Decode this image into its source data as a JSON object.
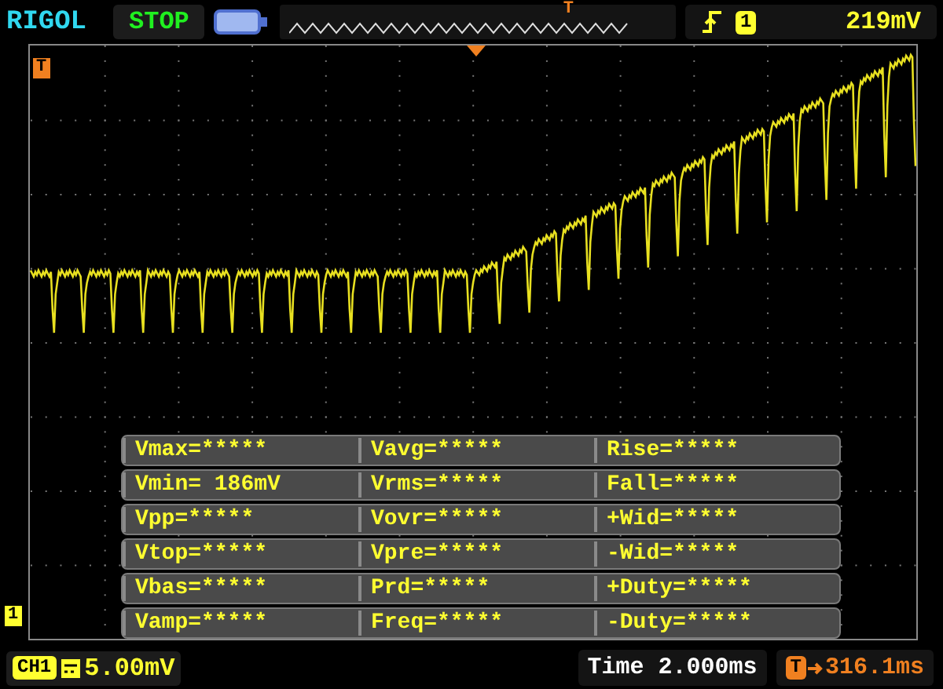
{
  "brand": "RIGOL",
  "run_state": "STOP",
  "memory_marker": "T",
  "trigger": {
    "channel": "1",
    "level": "219mV"
  },
  "trigger_level_marker": "T",
  "channel_marker": "1",
  "measurements": [
    [
      "Vmax=*****",
      "Vavg=*****",
      "Rise=*****"
    ],
    [
      "Vmin= 186mV",
      "Vrms=*****",
      "Fall=*****"
    ],
    [
      "Vpp=*****",
      "Vovr=*****",
      "+Wid=*****"
    ],
    [
      "Vtop=*****",
      "Vpre=*****",
      "-Wid=*****"
    ],
    [
      "Vbas=*****",
      "Prd=*****",
      "+Duty=*****"
    ],
    [
      "Vamp=*****",
      "Freq=*****",
      "-Duty=*****"
    ]
  ],
  "channel": {
    "name": "CH1",
    "scale": "5.00mV"
  },
  "timebase": "Time 2.000ms",
  "offset": {
    "marker": "T",
    "value": "316.1ms"
  }
}
